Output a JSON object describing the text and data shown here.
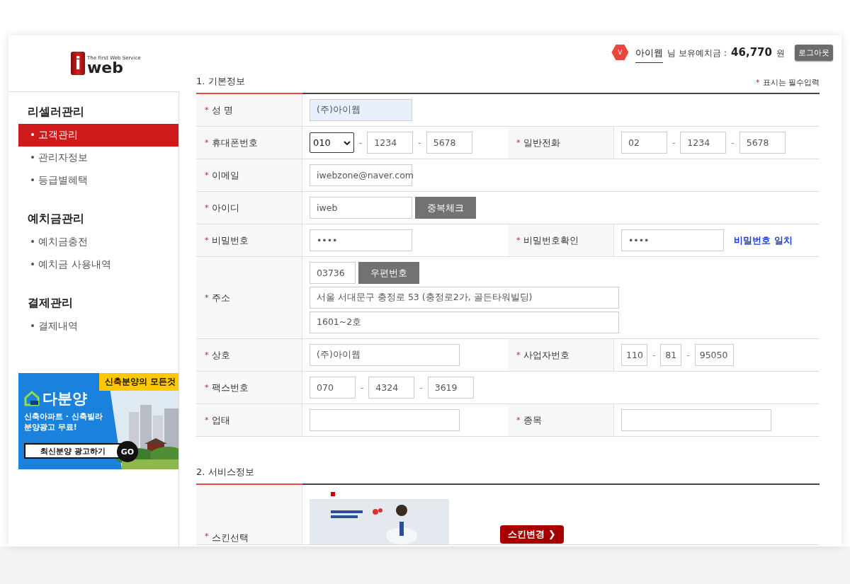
{
  "header": {
    "logo": {
      "letter": "i",
      "word": "web",
      "tagline": "The First Web Service"
    },
    "grade_badge": "V",
    "user_name": "아이웹",
    "balance_label": "님 보유예치금 :",
    "balance": "46,770",
    "currency": "원",
    "logout": "로그아웃"
  },
  "sidebar": {
    "groups": [
      {
        "title": "리셀러관리",
        "items": [
          {
            "label": "• 고객관리",
            "selected": true
          },
          {
            "label": "• 관리자정보",
            "selected": false
          },
          {
            "label": "• 등급별혜택",
            "selected": false
          }
        ]
      },
      {
        "title": "예치금관리",
        "items": [
          {
            "label": "• 예치금충전",
            "selected": false
          },
          {
            "label": "• 예치금 사용내역",
            "selected": false
          }
        ]
      },
      {
        "title": "결제관리",
        "items": [
          {
            "label": "• 결제내역",
            "selected": false
          }
        ]
      }
    ],
    "banner": {
      "tag": "신축분양의 모든것",
      "brand": "다분양",
      "line1": "신축아파트 · 신축빌라",
      "line2": "분양광고 무료!",
      "cta": "최신분양 광고하기",
      "go": "GO"
    }
  },
  "basic_info": {
    "title": "1. 기본정보",
    "required_mark": "*",
    "required_note": "표시는 필수입력",
    "rows": [
      {
        "cells": [
          {
            "label": "성 명",
            "required": true,
            "lines": [
              [
                {
                  "kind": "input",
                  "value": "(주)아이웹",
                  "highlighted": true
                }
              ]
            ]
          }
        ]
      },
      {
        "cells": [
          {
            "label": "휴대폰번호",
            "required": true,
            "lines": [
              [
                {
                  "kind": "select",
                  "value": "010"
                },
                {
                  "kind": "sep",
                  "text": "-"
                },
                {
                  "kind": "short-input",
                  "value": "1234",
                  "highlighted": false
                },
                {
                  "kind": "sep",
                  "text": "-"
                },
                {
                  "kind": "short-input",
                  "value": "5678",
                  "highlighted": false
                }
              ]
            ]
          },
          {
            "label": "일반전화",
            "required": true,
            "lines": [
              [
                {
                  "kind": "short-input",
                  "value": "02",
                  "highlighted": false
                },
                {
                  "kind": "sep",
                  "text": "-"
                },
                {
                  "kind": "short-input",
                  "value": "1234",
                  "highlighted": false
                },
                {
                  "kind": "sep",
                  "text": "-"
                },
                {
                  "kind": "short-input",
                  "value": "5678",
                  "highlighted": false
                }
              ]
            ]
          }
        ]
      },
      {
        "cells": [
          {
            "label": "이메일",
            "required": true,
            "lines": [
              [
                {
                  "kind": "input",
                  "value": "iwebzone@naver.com",
                  "highlighted": false
                }
              ]
            ]
          }
        ]
      },
      {
        "cells": [
          {
            "label": "아이디",
            "required": true,
            "lines": [
              [
                {
                  "kind": "input",
                  "value": "iweb",
                  "highlighted": false
                },
                {
                  "kind": "button",
                  "text": "중복체크"
                }
              ]
            ]
          }
        ]
      },
      {
        "cells": [
          {
            "label": "비밀번호",
            "required": true,
            "lines": [
              [
                {
                  "kind": "input",
                  "value": "••••",
                  "highlighted": false
                }
              ]
            ]
          },
          {
            "label": "비밀번호확인",
            "required": true,
            "lines": [
              [
                {
                  "kind": "input",
                  "value": "••••",
                  "highlighted": false
                },
                {
                  "kind": "note",
                  "text": "비밀번호 일치"
                }
              ]
            ]
          }
        ]
      },
      {
        "cells": [
          {
            "label": "주소",
            "required": true,
            "lines": [
              [
                {
                  "kind": "short-input",
                  "value": "03736",
                  "highlighted": false
                },
                {
                  "kind": "button",
                  "text": "우편번호"
                }
              ],
              [
                {
                  "kind": "long-input",
                  "value": "서울 서대문구 충정로 53 (충정로2가, 골든타워빌딩)",
                  "highlighted": false
                }
              ],
              [
                {
                  "kind": "long-input",
                  "value": "1601~2호",
                  "highlighted": false
                }
              ]
            ]
          }
        ]
      },
      {
        "cells": [
          {
            "label": "상호",
            "required": true,
            "lines": [
              [
                {
                  "kind": "wide-input",
                  "value": "(주)아이웹",
                  "highlighted": false
                }
              ]
            ]
          },
          {
            "label": "사업자번호",
            "required": true,
            "lines": [
              [
                {
                  "kind": "tiny-input",
                  "value": "110",
                  "highlighted": false
                },
                {
                  "kind": "sep",
                  "text": "-"
                },
                {
                  "kind": "narrow-input",
                  "value": "81",
                  "highlighted": false
                },
                {
                  "kind": "sep",
                  "text": "-"
                },
                {
                  "kind": "mid-input",
                  "value": "95050",
                  "highlighted": false
                }
              ]
            ]
          }
        ]
      },
      {
        "cells": [
          {
            "label": "팩스번호",
            "required": true,
            "lines": [
              [
                {
                  "kind": "short-input",
                  "value": "070",
                  "highlighted": false
                },
                {
                  "kind": "sep",
                  "text": "-"
                },
                {
                  "kind": "short-input",
                  "value": "4324",
                  "highlighted": false
                },
                {
                  "kind": "sep",
                  "text": "-"
                },
                {
                  "kind": "short-input",
                  "value": "3619",
                  "highlighted": false
                }
              ]
            ]
          }
        ]
      },
      {
        "cells": [
          {
            "label": "업태",
            "required": true,
            "lines": [
              [
                {
                  "kind": "wide-input",
                  "highlighted": false
                }
              ]
            ]
          },
          {
            "label": "종목",
            "required": true,
            "lines": [
              [
                {
                  "kind": "wide-input",
                  "highlighted": false
                }
              ]
            ]
          }
        ]
      }
    ]
  },
  "service_info": {
    "title": "2. 서비스정보",
    "rows": [
      {
        "label": "스킨선택",
        "required": true,
        "button": "스킨변경 ❯"
      }
    ]
  }
}
